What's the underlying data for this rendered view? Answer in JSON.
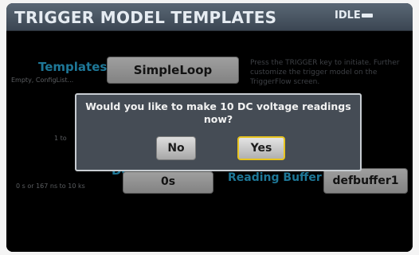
{
  "header": {
    "title": "TRIGGER MODEL TEMPLATES",
    "status": "IDLE"
  },
  "templates": {
    "label": "Templates",
    "hint": "Empty, ConfigList...",
    "value": "SimpleLoop",
    "help": "Press the TRIGGER key to initiate. Further customize the trigger model on the TriggerFlow screen."
  },
  "count": {
    "hint_partial": "1 to"
  },
  "delay": {
    "label": "Delay",
    "hint": "0 s or 167 ns to 10 ks",
    "value": "0s"
  },
  "reading_buffer": {
    "label": "Reading Buffer",
    "value": "defbuffer1"
  },
  "dialog": {
    "message": "Would you like to make 10 DC voltage readings now?",
    "no_label": "No",
    "yes_label": "Yes"
  }
}
